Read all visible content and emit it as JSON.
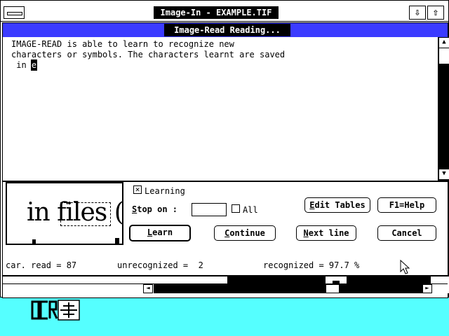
{
  "window": {
    "title": "Image-In - EXAMPLE.TIF",
    "down_arrow": "⇩",
    "up_arrow": "⇧"
  },
  "dialog": {
    "title": "Image-Read  Reading...",
    "text_lines": [
      "IMAGE-READ is able to learn to recognize new",
      "characters or symbols. The characters learnt are saved",
      " in "
    ],
    "cursor_char": "e",
    "preview": {
      "text": "in files ("
    },
    "options": {
      "learning_label": "Learning",
      "learning_checked": true,
      "stop_on_label": "Stop on :",
      "stop_on_value": "",
      "all_label": "All",
      "all_checked": false
    },
    "buttons": {
      "learn": "Learn",
      "continue": "Continue",
      "next_line": "Next line",
      "cancel": "Cancel",
      "edit_tables": "Edit Tables",
      "help": "F1=Help"
    },
    "status": {
      "car_read": "car. read = 87",
      "unrecognized": "unrecognized =  2",
      "recognized": "recognized = 97.7 %"
    }
  },
  "scroll": {
    "left_arrow": "◄",
    "right_arrow": "►",
    "up_arrow": "▲",
    "down_arrow": "▼"
  },
  "taskbar": {
    "app_icon": "ocr-app-icon"
  },
  "colors": {
    "desktop": "#55ffff",
    "caption": "#3b3bff",
    "title_bg": "#000000"
  }
}
